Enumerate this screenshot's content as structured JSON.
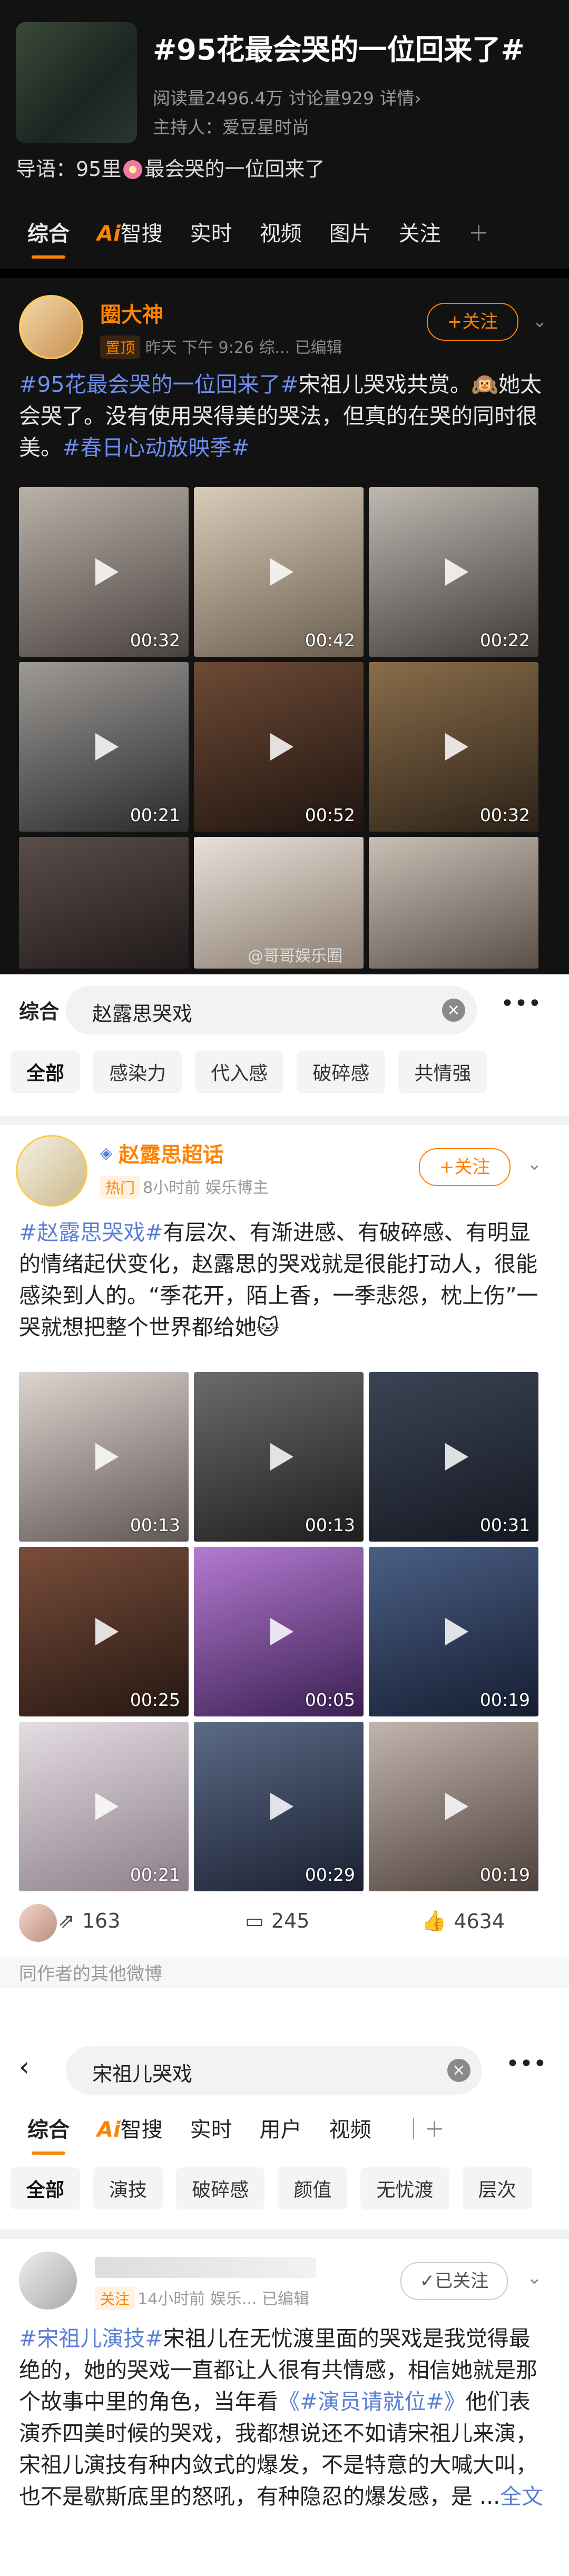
{
  "topic": {
    "title": "#95花最会哭的一位回来了#",
    "stats": "阅读量2496.4万  讨论量929  详情›",
    "host": "主持人：爱豆星时尚",
    "guide_prefix": "导语：95里",
    "guide_suffix": "最会哭的一位回来了"
  },
  "tabs1": [
    "综合",
    "智搜",
    "实时",
    "视频",
    "图片",
    "关注"
  ],
  "post1": {
    "user": "圈大神",
    "tag": "置顶",
    "time": "昨天 下午 9:26  综...  已编辑",
    "follow": "+关注",
    "hashtag1": "#95花最会哭的一位回来了#",
    "text1": "宋祖儿哭戏共赏。🙉她太会哭了。没有使用哭得美的哭法，但真的在哭的同时很美。",
    "hashtag2": "#春日心动放映季#",
    "durations": [
      "00:32",
      "00:42",
      "00:22",
      "00:21",
      "00:52",
      "00:32"
    ],
    "watermark": "@哥哥娱乐圈"
  },
  "search2": {
    "query": "赵露思哭戏",
    "tab_left": "综合",
    "chips": [
      "全部",
      "感染力",
      "代入感",
      "破碎感",
      "共情强"
    ]
  },
  "post2": {
    "user": "赵露思超话",
    "tag": "热门",
    "time": "8小时前  娱乐博主",
    "follow": "+关注",
    "hashtag": "#赵露思哭戏#",
    "text": "有层次、有渐进感、有破碎感、有明显的情绪起伏变化，赵露思的哭戏就是很能打动人，很能感染到人的。“季花开，陌上香，一季悲怨，枕上伤”一哭就想把整个世界都给她🐱",
    "durations": [
      "00:13",
      "00:13",
      "00:31",
      "00:25",
      "00:05",
      "00:19",
      "00:21",
      "00:29",
      "00:19"
    ],
    "reposts": "163",
    "comments": "245",
    "likes": "4634",
    "more_label": "同作者的其他微博"
  },
  "search3": {
    "query": "宋祖儿哭戏",
    "tabs": [
      "综合",
      "智搜",
      "实时",
      "用户",
      "视频"
    ],
    "chips": [
      "全部",
      "演技",
      "破碎感",
      "颜值",
      "无忧渡",
      "层次"
    ]
  },
  "post3": {
    "tag": "关注",
    "time": "14小时前  娱乐...  已编辑",
    "follow": "✓已关注",
    "hashtag1": "#宋祖儿演技#",
    "text1": "宋祖儿在无忧渡里面的哭戏是我觉得最绝的，她的哭戏一直都让人很有共情感，相信她就是那个故事中里的角色，当年看",
    "hashtag2": "《#演员请就位#》",
    "text2": "他们表演乔四美时候的哭戏，我都想说还不如请宋祖儿来演，宋祖儿演技有种内敛式的爆发，不是特意的大喊大叫，也不是歇斯底里的怒吼，有种隐忍的爆发感，是 ...",
    "more": "全文"
  },
  "colors": {
    "accent": "#ff8200",
    "link": "#5b7fd6",
    "dark_bg": "#121212"
  }
}
